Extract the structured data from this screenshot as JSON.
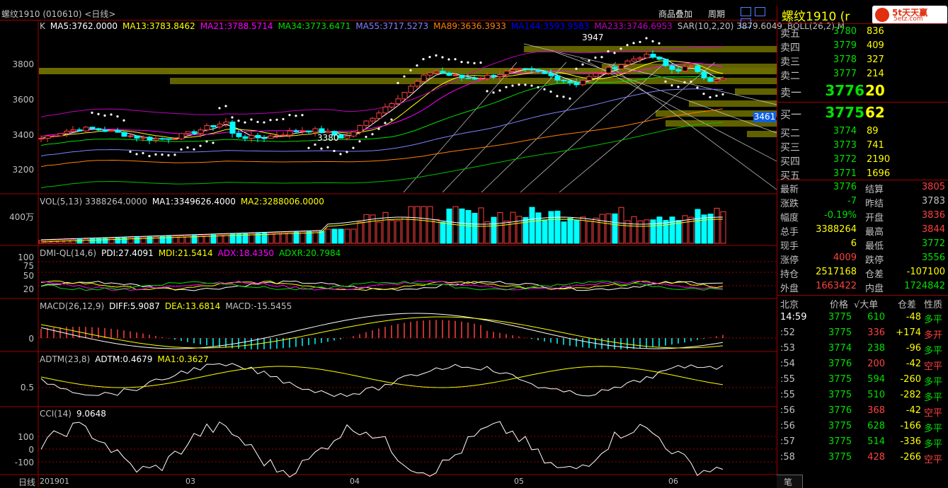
{
  "title": "螺纹1910 (010610) <日线>",
  "header_buttons": {
    "overlay": "商品叠加",
    "period": "周期"
  },
  "panel_title": "螺纹1910 (r",
  "logo": {
    "text": "5t天天赢",
    "sub": "5etz.com"
  },
  "main_indicators": [
    {
      "text": "K",
      "color": "#c0c0c0"
    },
    {
      "text": "MA5:3762.0000",
      "color": "#ffffff"
    },
    {
      "text": "MA13:3783.8462",
      "color": "#ffff00"
    },
    {
      "text": "MA21:3788.5714",
      "color": "#ff00ff"
    },
    {
      "text": "MA34:3773.6471",
      "color": "#00e000"
    },
    {
      "text": "MA55:3717.5273",
      "color": "#8080ff"
    },
    {
      "text": "MA89:3636.3933",
      "color": "#ff8000"
    },
    {
      "text": "MA144:3593.9583",
      "color": "#0000ff"
    },
    {
      "text": "MA233:3746.6953",
      "color": "#c000c0"
    },
    {
      "text": "SAR(10,2,20)  3879.6049",
      "color": "#c0c0c0"
    },
    {
      "text": "BOLL(26,2)  M",
      "color": "#c0c0c0"
    }
  ],
  "price_axis": [
    "3800",
    "3600",
    "3400",
    "3200"
  ],
  "price_marks": {
    "high": "3947",
    "low": "3380",
    "current_box": "3461"
  },
  "vol_indicators": [
    {
      "text": "VOL(5,13)  3388264.0000",
      "color": "#c0c0c0"
    },
    {
      "text": "MA1:3349626.4000",
      "color": "#ffffff"
    },
    {
      "text": "MA2:3288006.0000",
      "color": "#ffff00"
    }
  ],
  "vol_axis": [
    "400万"
  ],
  "dmi_indicators": [
    {
      "text": "DMI-QL(14,6)",
      "color": "#c0c0c0"
    },
    {
      "text": "PDI:27.4091",
      "color": "#ffffff"
    },
    {
      "text": "MDI:21.5414",
      "color": "#ffff00"
    },
    {
      "text": "ADX:18.4350",
      "color": "#ff00ff"
    },
    {
      "text": "ADXR:20.7984",
      "color": "#00e000"
    }
  ],
  "dmi_axis": [
    "100",
    "75",
    "50",
    "20"
  ],
  "macd_indicators": [
    {
      "text": "MACD(26,12,9)",
      "color": "#c0c0c0"
    },
    {
      "text": "DIFF:5.9087",
      "color": "#ffffff"
    },
    {
      "text": "DEA:13.6814",
      "color": "#ffff00"
    },
    {
      "text": "MACD:-15.5455",
      "color": "#c0c0c0"
    }
  ],
  "macd_axis": [
    "0"
  ],
  "adtm_indicators": [
    {
      "text": "ADTM(23,8)",
      "color": "#c0c0c0"
    },
    {
      "text": "ADTM:0.4679",
      "color": "#ffffff"
    },
    {
      "text": "MA1:0.3627",
      "color": "#ffff00"
    }
  ],
  "adtm_axis": [
    "0.5"
  ],
  "cci_indicators": [
    {
      "text": "CCI(14)",
      "color": "#c0c0c0"
    },
    {
      "text": "9.0648",
      "color": "#ffffff"
    }
  ],
  "cci_axis": [
    "100",
    "0",
    "-100"
  ],
  "time_axis": {
    "tab": "日线",
    "labels": [
      "201901",
      "03",
      "04",
      "05",
      "06"
    ]
  },
  "order_book": {
    "asks": [
      {
        "label": "卖五",
        "price": "3780",
        "vol": "836"
      },
      {
        "label": "卖四",
        "price": "3779",
        "vol": "409"
      },
      {
        "label": "卖三",
        "price": "3778",
        "vol": "327"
      },
      {
        "label": "卖二",
        "price": "3777",
        "vol": "214"
      },
      {
        "label": "卖一",
        "price": "3776",
        "vol": "20"
      }
    ],
    "bids": [
      {
        "label": "买一",
        "price": "3775",
        "vol": "62"
      },
      {
        "label": "买二",
        "price": "3774",
        "vol": "89"
      },
      {
        "label": "买三",
        "price": "3773",
        "vol": "741"
      },
      {
        "label": "买四",
        "price": "3772",
        "vol": "2190"
      },
      {
        "label": "买五",
        "price": "3771",
        "vol": "1696"
      }
    ]
  },
  "stats": [
    {
      "l1": "最新",
      "v1": "3776",
      "c1": "#00e000",
      "l2": "结算",
      "v2": "3805",
      "c2": "#ff4040"
    },
    {
      "l1": "涨跌",
      "v1": "-7",
      "c1": "#00e000",
      "l2": "昨结",
      "v2": "3783",
      "c2": "#c0c0c0"
    },
    {
      "l1": "幅度",
      "v1": "-0.19%",
      "c1": "#00e000",
      "l2": "开盘",
      "v2": "3836",
      "c2": "#ff4040"
    },
    {
      "l1": "总手",
      "v1": "3388264",
      "c1": "#ffff00",
      "l2": "最高",
      "v2": "3844",
      "c2": "#ff4040"
    },
    {
      "l1": "现手",
      "v1": "6",
      "c1": "#ffff00",
      "l2": "最低",
      "v2": "3772",
      "c2": "#00e000"
    },
    {
      "l1": "涨停",
      "v1": "4009",
      "c1": "#ff4040",
      "l2": "跌停",
      "v2": "3556",
      "c2": "#00e000"
    },
    {
      "l1": "持仓",
      "v1": "2517168",
      "c1": "#ffff00",
      "l2": "仓差",
      "v2": "-107100",
      "c2": "#ffff00"
    },
    {
      "l1": "外盘",
      "v1": "1663422",
      "c1": "#ff4040",
      "l2": "内盘",
      "v2": "1724842",
      "c2": "#00e000"
    }
  ],
  "ticks_header": {
    "place": "北京",
    "price": "价格",
    "big": "√大单",
    "diff": "仓差",
    "nature": "性质"
  },
  "ticks": [
    {
      "time": "14:59",
      "price": "3775",
      "vol": "610",
      "vc": "#00e000",
      "diff": "-48",
      "nature": "多平",
      "nc": "#00e000"
    },
    {
      "time": ":52",
      "price": "3775",
      "vol": "336",
      "vc": "#ff4040",
      "diff": "+174",
      "nature": "多开",
      "nc": "#ff4040"
    },
    {
      "time": ":53",
      "price": "3774",
      "vol": "238",
      "vc": "#00e000",
      "diff": "-96",
      "nature": "多平",
      "nc": "#00e000"
    },
    {
      "time": ":54",
      "price": "3776",
      "vol": "200",
      "vc": "#ff4040",
      "diff": "-42",
      "nature": "空平",
      "nc": "#ff4040"
    },
    {
      "time": ":55",
      "price": "3775",
      "vol": "594",
      "vc": "#00e000",
      "diff": "-260",
      "nature": "多平",
      "nc": "#00e000"
    },
    {
      "time": ":55",
      "price": "3775",
      "vol": "510",
      "vc": "#00e000",
      "diff": "-282",
      "nature": "多平",
      "nc": "#00e000"
    },
    {
      "time": ":56",
      "price": "3776",
      "vol": "368",
      "vc": "#ff4040",
      "diff": "-42",
      "nature": "空平",
      "nc": "#ff4040"
    },
    {
      "time": ":56",
      "price": "3775",
      "vol": "628",
      "vc": "#00e000",
      "diff": "-166",
      "nature": "多平",
      "nc": "#00e000"
    },
    {
      "time": ":57",
      "price": "3775",
      "vol": "514",
      "vc": "#00e000",
      "diff": "-336",
      "nature": "多平",
      "nc": "#00e000"
    },
    {
      "time": ":58",
      "price": "3775",
      "vol": "428",
      "vc": "#ff4040",
      "diff": "-266",
      "nature": "空平",
      "nc": "#ff4040"
    }
  ],
  "bottom_tab": "笔",
  "colors": {
    "up": "#ff4040",
    "down": "#00ffff",
    "grid": "#a00000",
    "label": "#c0c0c0"
  }
}
